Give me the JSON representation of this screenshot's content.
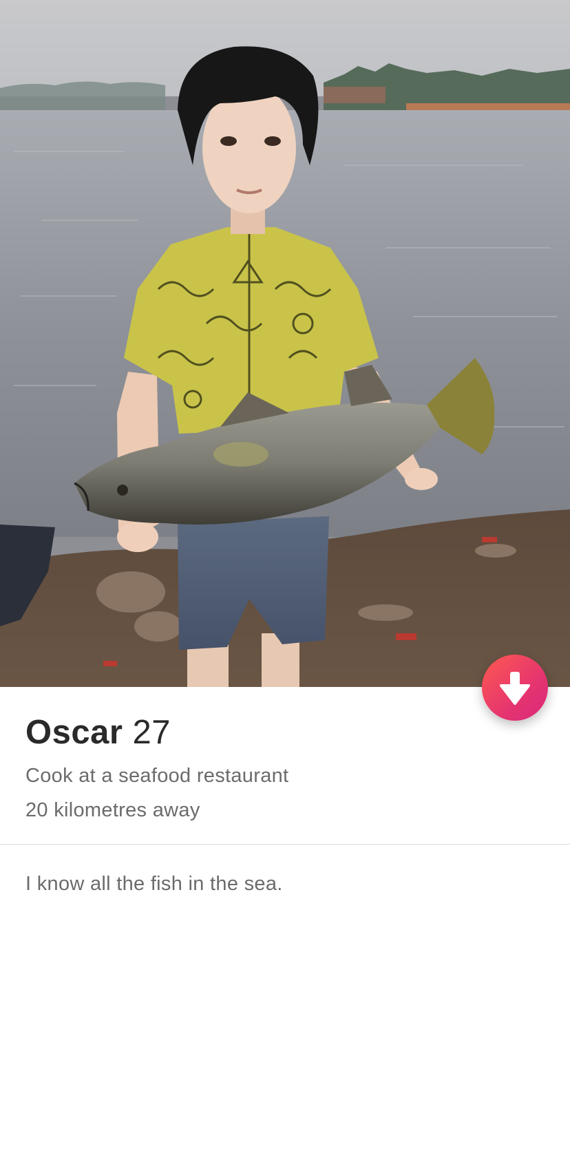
{
  "profile": {
    "name": "Oscar",
    "age": "27",
    "job": "Cook at a seafood restaurant",
    "distance": "20 kilometres away",
    "bio": "I know all the fish in the sea."
  },
  "photo": {
    "description_icon": "profile-photo"
  },
  "actions": {
    "collapse_icon": "arrow-down-icon"
  },
  "colors": {
    "accent_start": "#ff5a4f",
    "accent_end": "#d9287a",
    "name_text": "#2a2a2a",
    "secondary_text": "#6b6b6b"
  }
}
